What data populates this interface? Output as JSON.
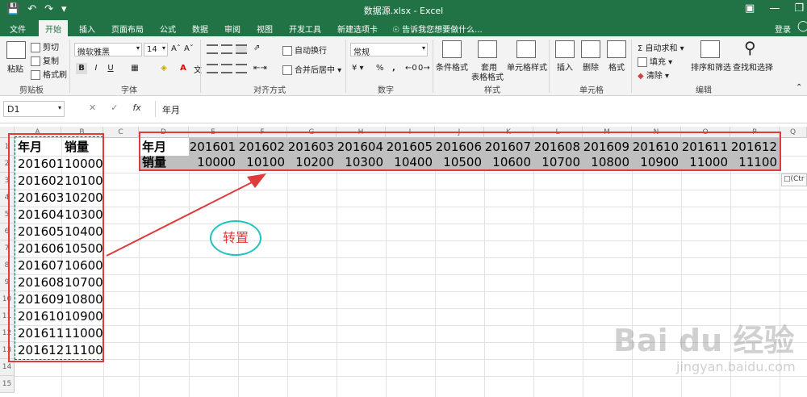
{
  "window": {
    "title": "数据源.xlsx - Excel",
    "qat": {
      "save_icon": "save-icon",
      "undo_icon": "undo-icon",
      "redo_icon": "redo-icon"
    }
  },
  "tabs": [
    "文件",
    "开始",
    "插入",
    "页面布局",
    "公式",
    "数据",
    "审阅",
    "视图",
    "开发工具",
    "新建选项卡"
  ],
  "active_tab": "开始",
  "tell_me": "告诉我您想要做什么...",
  "login": "登录",
  "ribbon": {
    "clipboard": {
      "paste": "粘贴",
      "cut": "剪切",
      "copy": "复制",
      "format_painter": "格式刷",
      "label": "剪贴板"
    },
    "font": {
      "name": "微软雅黑",
      "size": "14",
      "bold": "B",
      "italic": "I",
      "underline": "U",
      "font_color": "A",
      "label": "字体"
    },
    "alignment": {
      "wrap": "自动换行",
      "merge": "合并后居中",
      "label": "对齐方式"
    },
    "number": {
      "format": "常规",
      "percent": "%",
      "comma": ",",
      "label": "数字"
    },
    "styles": {
      "conditional": "条件格式",
      "table_line1": "套用",
      "table_line2": "表格格式",
      "cell_styles": "单元格样式",
      "label": "样式"
    },
    "cells": {
      "insert": "插入",
      "delete": "删除",
      "format": "格式",
      "label": "单元格"
    },
    "editing": {
      "autosum": "自动求和",
      "fill": "填充",
      "clear": "清除",
      "sort": "排序和筛选",
      "find": "查找和选择",
      "label": "编辑"
    }
  },
  "formula_bar": {
    "name_box": "D1",
    "fx": "fx",
    "value": "年月"
  },
  "columns": [
    "A",
    "B",
    "C",
    "D",
    "E",
    "F",
    "G",
    "H",
    "I",
    "J",
    "K",
    "L",
    "M",
    "N",
    "O",
    "P",
    "Q"
  ],
  "rows": [
    "1",
    "2",
    "3",
    "4",
    "5",
    "6",
    "7",
    "8",
    "9",
    "10",
    "11",
    "12",
    "13",
    "14",
    "15"
  ],
  "source_table": {
    "headers": [
      "年月",
      "销量"
    ],
    "rows": [
      [
        "201601",
        "10000"
      ],
      [
        "201602",
        "10100"
      ],
      [
        "201603",
        "10200"
      ],
      [
        "201604",
        "10300"
      ],
      [
        "201605",
        "10400"
      ],
      [
        "201606",
        "10500"
      ],
      [
        "201607",
        "10600"
      ],
      [
        "201608",
        "10700"
      ],
      [
        "201609",
        "10800"
      ],
      [
        "201610",
        "10900"
      ],
      [
        "201611",
        "11000"
      ],
      [
        "201612",
        "11100"
      ]
    ]
  },
  "transposed_table": {
    "row1_header": "年月",
    "row1": [
      "201601",
      "201602",
      "201603",
      "201604",
      "201605",
      "201606",
      "201607",
      "201608",
      "201609",
      "201610",
      "201611",
      "201612"
    ],
    "row2_header": "销量",
    "row2": [
      "10000",
      "10100",
      "10200",
      "10300",
      "10400",
      "10500",
      "10600",
      "10700",
      "10800",
      "10900",
      "11000",
      "11100"
    ]
  },
  "annotation": "转置",
  "paste_options": "(Ctr",
  "watermark": {
    "brand": "Bai du 经验",
    "url": "jingyan.baidu.com"
  },
  "colors": {
    "excel_green": "#217346",
    "highlight_red": "#e03a3a",
    "annotation_cyan": "#22c2c2",
    "shade": "#bfbfbf"
  }
}
